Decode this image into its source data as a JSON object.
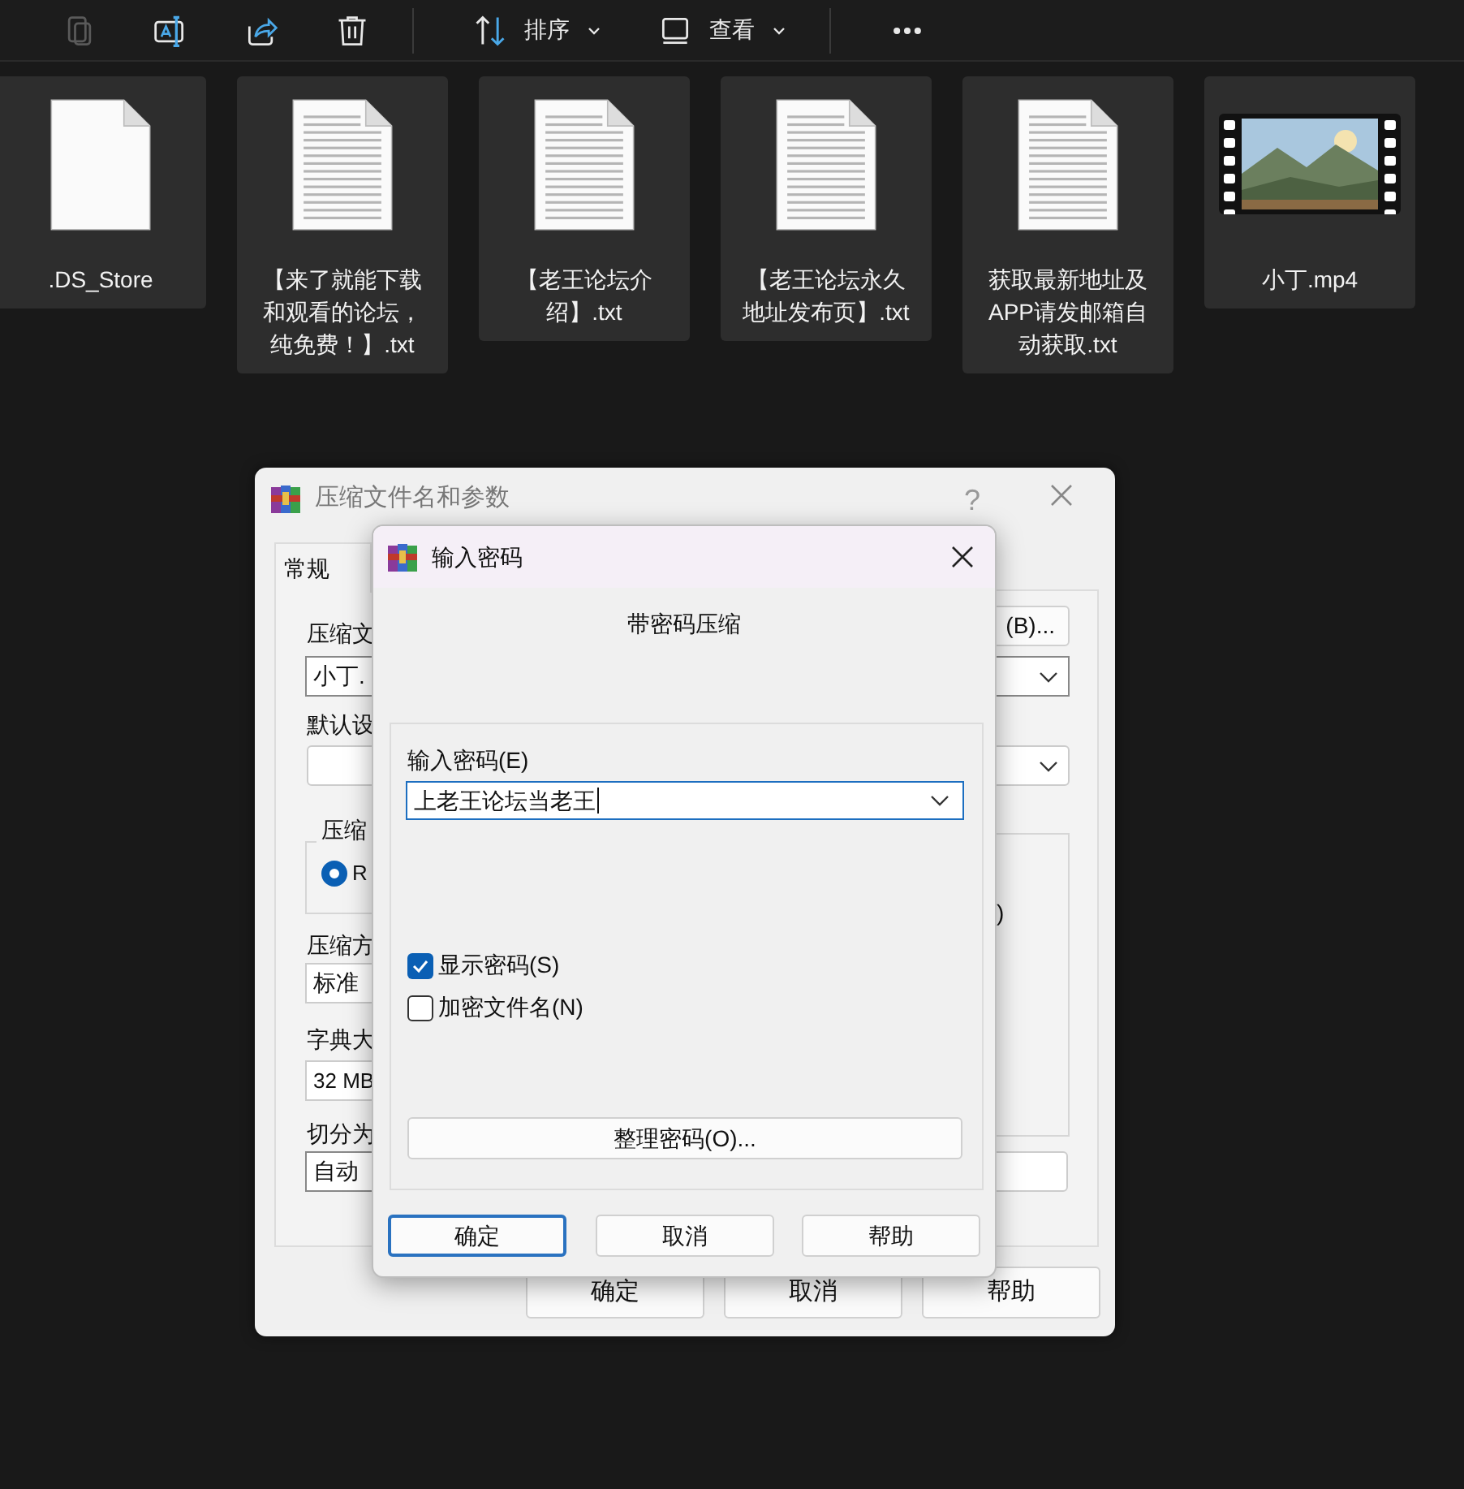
{
  "toolbar": [
    {
      "kind": "paste",
      "disabled": true
    },
    {
      "kind": "rename",
      "disabled": false
    },
    {
      "kind": "share",
      "disabled": false
    },
    {
      "kind": "delete",
      "disabled": false
    },
    {
      "kind": "sort",
      "label": "排序",
      "disabled": false
    },
    {
      "kind": "view",
      "label": "查看",
      "disabled": false
    },
    {
      "kind": "more",
      "disabled": false
    }
  ],
  "files": [
    {
      "name": ".DS_Store",
      "kind": "blank"
    },
    {
      "name": "【来了就能下载和观看的论坛，纯免费！】.txt",
      "kind": "text"
    },
    {
      "name": "【老王论坛介绍】.txt",
      "kind": "text"
    },
    {
      "name": "【老王论坛永久地址发布页】.txt",
      "kind": "text"
    },
    {
      "name": "获取最新地址及APP请发邮箱自动获取.txt",
      "kind": "text"
    },
    {
      "name": "小丁.mp4",
      "kind": "video"
    }
  ],
  "archive_dialog": {
    "title": "压缩文件名和参数",
    "help": "?",
    "tabs": [
      {
        "label": "常规",
        "selected": true
      }
    ],
    "archive_name_label": "压缩文",
    "archive_name_value": "小丁.",
    "browse_button": "(B)...",
    "profile_label": "默认设",
    "format_group_label": "压缩",
    "format_option": {
      "label": "R",
      "selected": true
    },
    "method_label": "压缩方",
    "method_value": "标准",
    "dictionary_label": "字典大",
    "dictionary_value": "32 MB",
    "split_label": "切分为",
    "split_value": "自动",
    "options_fragment": ")",
    "buttons": [
      "确定",
      "取消",
      "帮助"
    ]
  },
  "password_dialog": {
    "title": "输入密码",
    "heading": "带密码压缩",
    "password_label": "输入密码(E)",
    "password_value": "上老王论坛当老王",
    "checkboxes": [
      {
        "label": "显示密码(S)",
        "checked": true
      },
      {
        "label": "加密文件名(N)",
        "checked": false
      }
    ],
    "organize_button": "整理密码(O)...",
    "buttons": [
      {
        "label": "确定",
        "focused": true
      },
      {
        "label": "取消",
        "focused": false
      },
      {
        "label": "帮助",
        "focused": false
      }
    ]
  }
}
